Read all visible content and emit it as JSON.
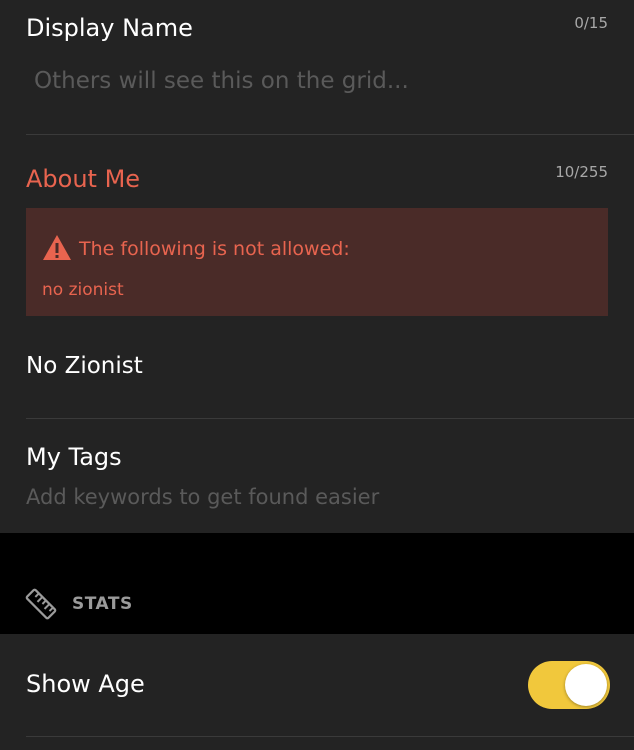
{
  "display_name": {
    "title": "Display Name",
    "counter": "0/15",
    "placeholder": "Others will see this on the grid..."
  },
  "about_me": {
    "title": "About Me",
    "counter": "10/255",
    "error_heading": "The following is not allowed:",
    "error_term": "no zionist",
    "value": "No Zionist"
  },
  "tags": {
    "title": "My Tags",
    "hint": "Add keywords to get found easier"
  },
  "stats": {
    "label": "STATS",
    "icon": "ruler-icon"
  },
  "show_age": {
    "label": "Show Age",
    "enabled": true
  },
  "colors": {
    "background": "#232323",
    "error": "#e8644f",
    "error_box": "#4a2b28",
    "toggle_on": "#f1c83c"
  }
}
